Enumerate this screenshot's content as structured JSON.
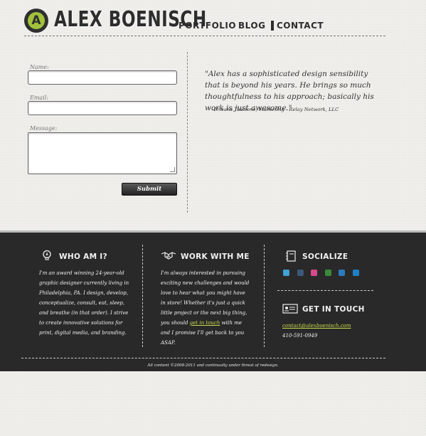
{
  "header": {
    "brand": "ALEX BOENISCH",
    "logo_glyph": "A",
    "nav": [
      {
        "label": "PORTFOLIO"
      },
      {
        "label": "BLOG"
      },
      {
        "label": "CONTACT",
        "active": true
      }
    ]
  },
  "form": {
    "name_label": "Name:",
    "email_label": "Email:",
    "message_label": "Message:",
    "name_value": "",
    "email_value": "",
    "message_value": "",
    "submit_label": "Submit"
  },
  "testimonial": {
    "quote": "\"Alex has a sophisticated design sensibility that is beyond his years. He brings so much thoughtfulness to his approach; basically his work is just awesome.\"",
    "attribution": "-Brieana Tascione, Marketing - Relay Network, LLC"
  },
  "footer": {
    "who": {
      "title": "WHO AM I?",
      "text": "I'm an award winning 24-year-old graphic designer currently living in Philadelphia, PA. I design, develop, conceptualize, consult, eat, sleep, and breathe (in that order). I strive to create innovative solutions for print, digital media, and branding."
    },
    "work": {
      "title": "WORK WITH ME",
      "text_before": "I'm always interested in pursuing exciting new challenges and would love to hear what you might have in store! Whether it's just a quick little project or the next big thing, you should ",
      "link": "get in touch",
      "text_after": " with me and I promise I'll get back to you ASAP."
    },
    "socialize": {
      "title": "SOCIALIZE",
      "icons": [
        "twitter-icon",
        "tumblr-icon",
        "dribbble-icon",
        "ifs-icon",
        "linkedin-icon",
        "behance-icon"
      ]
    },
    "contact": {
      "title": "GET IN TOUCH",
      "email": "contact@alexboenisch.com",
      "phone": "410-591-0949"
    },
    "copyright": "All content ©2008-2011 and continually under threat of redesign."
  },
  "colors": {
    "accent": "#a2c23b",
    "link": "#c8d84c",
    "footer_bg": "#2a2929",
    "page_bg": "#efeeea"
  }
}
